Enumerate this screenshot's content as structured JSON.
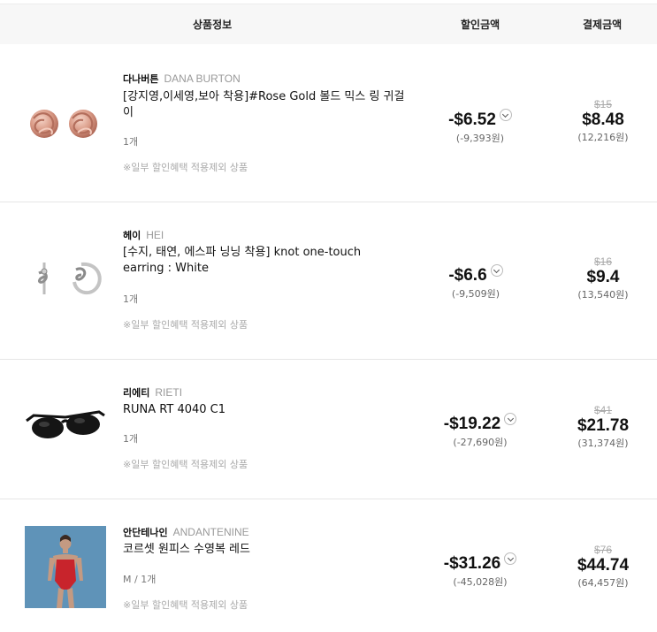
{
  "header": {
    "product_info": "상품정보",
    "discount_amount": "할인금액",
    "payment_amount": "결제금액"
  },
  "items": [
    {
      "image_icon": "rose-gold-knot-earrings-icon",
      "brand_kr": "다나버튼",
      "brand_en": "DANA BURTON",
      "name": "[강지영,이세영,보아 착용]#Rose Gold 볼드 믹스 링 귀걸이",
      "option": "1개",
      "note": "※일부 할인혜택 적용제외 상품",
      "discount": "-$6.52",
      "discount_won": "(-9,393원)",
      "original_price": "$15",
      "final_price": "$8.48",
      "final_won": "(12,216원)"
    },
    {
      "image_icon": "silver-knot-earring-icon",
      "brand_kr": "헤이",
      "brand_en": "HEI",
      "name": "[수지, 태연, 에스파 닝닝 착용] knot one-touch earring : White",
      "option": "1개",
      "note": "※일부 할인혜택 적용제외 상품",
      "discount": "-$6.6",
      "discount_won": "(-9,509원)",
      "original_price": "$16",
      "final_price": "$9.4",
      "final_won": "(13,540원)"
    },
    {
      "image_icon": "black-sunglasses-icon",
      "brand_kr": "리에티",
      "brand_en": "RIETI",
      "name": "RUNA RT 4040 C1",
      "option": "1개",
      "note": "※일부 할인혜택 적용제외 상품",
      "discount": "-$19.22",
      "discount_won": "(-27,690원)",
      "original_price": "$41",
      "final_price": "$21.78",
      "final_won": "(31,374원)"
    },
    {
      "image_icon": "red-swimsuit-model-photo",
      "brand_kr": "안단테나인",
      "brand_en": "ANDANTENINE",
      "name": "코르셋 원피스 수영복 레드",
      "option": "M / 1개",
      "note": "※일부 할인혜택 적용제외 상품",
      "discount": "-$31.26",
      "discount_won": "(-45,028원)",
      "original_price": "$76",
      "final_price": "$44.74",
      "final_won": "(64,457원)"
    }
  ],
  "colors": {
    "header_bg": "#f7f7f7",
    "muted_text": "#aaaaaa",
    "divider": "#e6e6e6",
    "swimsuit_red": "#c8242c",
    "photo_bg": "#5f93b8"
  }
}
